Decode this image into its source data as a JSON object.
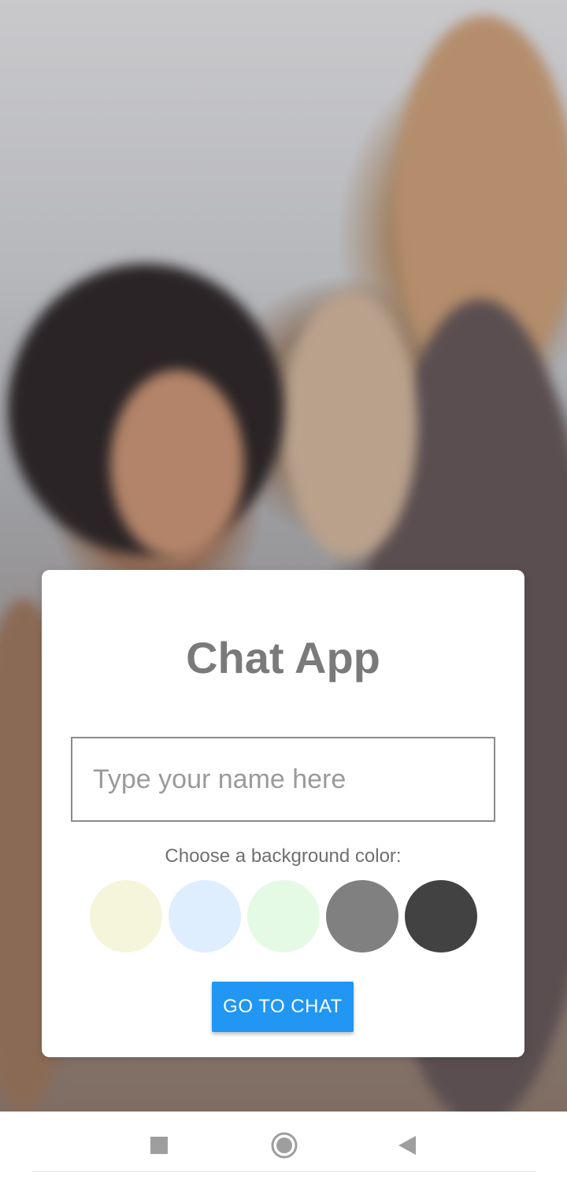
{
  "card": {
    "title": "Chat App",
    "name_input": {
      "value": "",
      "placeholder": "Type your name here"
    },
    "color_label": "Choose a background color:",
    "color_options": [
      {
        "name": "beige",
        "hex": "#F5F5DC"
      },
      {
        "name": "light-blue",
        "hex": "#DEEEFF"
      },
      {
        "name": "light-green",
        "hex": "#E5FAE5"
      },
      {
        "name": "gray",
        "hex": "#808080"
      },
      {
        "name": "dark-gray",
        "hex": "#424242"
      }
    ],
    "go_button_label": "GO TO CHAT",
    "accent_color": "#2196F3"
  },
  "navigation_bar": {
    "buttons": [
      {
        "icon": "recent-apps-square-icon"
      },
      {
        "icon": "home-circle-icon"
      },
      {
        "icon": "back-triangle-icon"
      }
    ]
  }
}
